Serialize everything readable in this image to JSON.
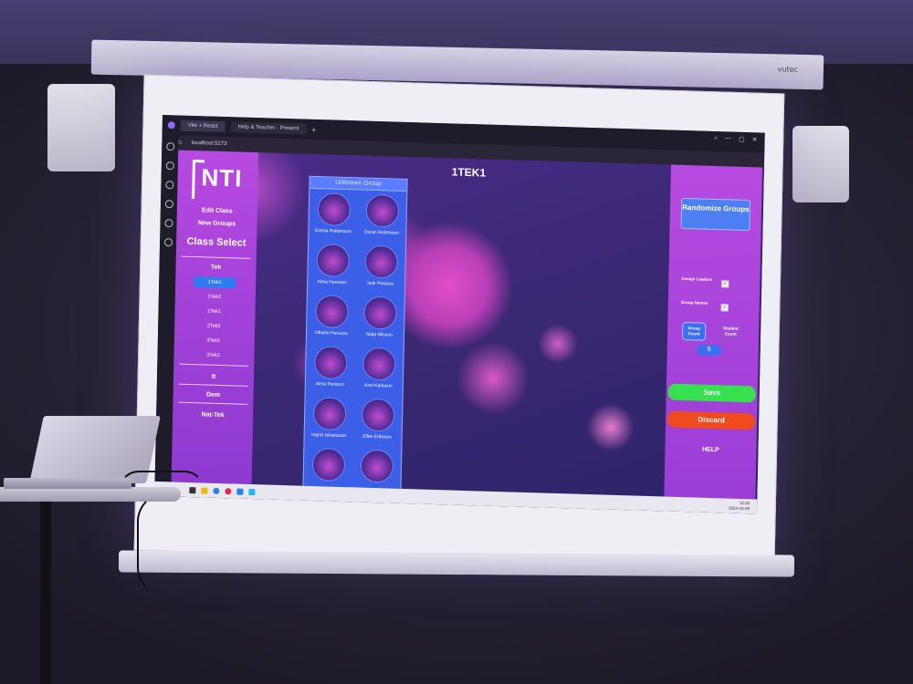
{
  "projector_brand": "vutec",
  "browser": {
    "tabs": [
      "Vite + React",
      "Help & Teacher - Present"
    ],
    "tab_plus": "+",
    "address": "localhost:5173",
    "nav": "‹  ›  ↻",
    "window_controls": [
      "⌕",
      "—",
      "▢",
      "✕"
    ]
  },
  "app": {
    "logo": "NTI",
    "menu": {
      "edit_class": "Edit Class",
      "new_groups": "New Groups",
      "class_select": "Class Select"
    },
    "class_groups": {
      "tek": "Tek",
      "it": "It",
      "dem": "Dem",
      "nat_tek": "Nat-Tek"
    },
    "tek_classes": [
      "1Tek1",
      "1Tek2",
      "2Tek1",
      "2Tek2",
      "3Tek1",
      "3Tek2"
    ],
    "selected_class_index": 0,
    "page_title": "1TEK1",
    "group": {
      "title": "Unknown Group",
      "students": [
        "Emma Pettersson",
        "Oscar Andersson",
        "Alma Hansson",
        "Isak Persson",
        "Vilhelm Persson",
        "Maja Nilsson",
        "Alma Persson",
        "Axel Karlsson",
        "Ingrid Johansson",
        "Ellen Eriksson"
      ]
    },
    "controls": {
      "randomize": "Randomize Groups",
      "assign_leaders": "Assign Leaders",
      "assign_leaders_checked": true,
      "group_names": "Group Names",
      "group_names_checked": true,
      "group_count": "Group Count",
      "student_count": "Student Count",
      "count_value": "6",
      "save": "Save",
      "discard": "Discard",
      "help": "HELP"
    },
    "tray": {
      "time": "12:00",
      "date": "2024-10-09"
    }
  },
  "colors": {
    "sidebar": "#b649e0",
    "selected_class": "#2e7cf0",
    "group_card": "#3b5fe6",
    "save": "#37e04f",
    "discard": "#f04a1f"
  }
}
